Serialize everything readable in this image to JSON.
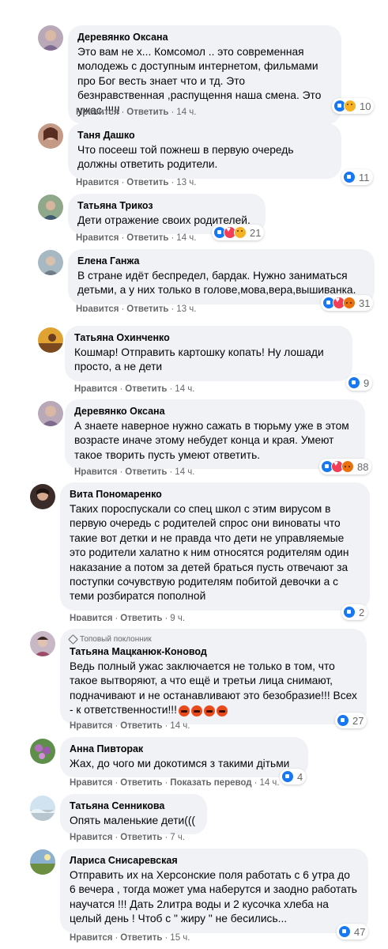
{
  "actions": {
    "like": "Нравится",
    "reply": "Ответить",
    "translate": "Показать перевод"
  },
  "colors": {
    "bubble": "#f0f2f5",
    "meta": "#65676b",
    "like": "#1877f2"
  },
  "comments": [
    {
      "author": "Деревянко Оксана",
      "text": "Это вам не х... Комсомол .. это современная молодежь с доступным интернетом, фильмами про Бог весть знает что и тд. Это безнравственная ,распущення наша смена. Это ужас.!!!!!",
      "time": "14 ч.",
      "reactions": [
        "like",
        "sad"
      ],
      "count": "10",
      "avatar": "woman-avatar"
    },
    {
      "author": "Таня Дашко",
      "text": "Что посееш той пожнеш в первую очередь должны ответить родители.",
      "time": "13 ч.",
      "reactions": [
        "like"
      ],
      "count": "11",
      "avatar": "woman-avatar"
    },
    {
      "author": "Татьяна Трикоз",
      "text": "Дети отражение своих родителей.",
      "time": "14 ч.",
      "reactions": [
        "like",
        "love",
        "sad"
      ],
      "count": "21",
      "avatar": "woman-avatar"
    },
    {
      "author": "Елена Ганжа",
      "text": "В стране идёт беспредел, бардак. Нужно заниматься детьми, а у них только в голове,мова,вера,вышиванка.",
      "time": "13 ч.",
      "reactions": [
        "like",
        "love",
        "angry"
      ],
      "count": "31",
      "avatar": "woman-avatar"
    },
    {
      "author": "Татьяна Охинченко",
      "text": "Кошмар! Отправить картошку копать! Ну лошади просто, а не дети",
      "time": "14 ч.",
      "reactions": [
        "like"
      ],
      "count": "9",
      "avatar": "woman-avatar"
    },
    {
      "author": "Деревянко Оксана",
      "text": "А знаете наверное нужно сажать в тюрьму уже в этом возрасте иначе этому небудет конца и края. Умеют такое творить пусть умеют ответить.",
      "time": "14 ч.",
      "reactions": [
        "like",
        "love",
        "angry"
      ],
      "count": "88",
      "avatar": "woman-avatar"
    },
    {
      "author": "Вита Пономаренко",
      "text": "Таких пороспускали со спец школ с этим вирусом в первую очередь с родителей спрос они виноваты что такие вот детки и не правда что дети не управляемые это родители халатно к ним относятся родителям один наказание а потом за детей браться пусть отвечают за поступки сочувствую родителям побитой девочки а с теми розбиратся пополной",
      "time": "9 ч.",
      "reactions": [
        "like"
      ],
      "count": "2",
      "avatar": "woman-avatar"
    },
    {
      "badge": "Топовый поклонник",
      "author": "Татьяна Мацканюк-Коновод",
      "text": "Ведь полный ужас заключается не только в том, что такое вытворяют, а что ещё и третьи лица снимают, подначивают и не останавливают это безобразие!!! Всех - к ответственности!!!",
      "time": "14 ч.",
      "reactions": [
        "like"
      ],
      "count": "27",
      "avatar": "woman-avatar"
    },
    {
      "author": "Анна Пивторак",
      "text": "Жах, до чого ми докотимся з такими дітьми",
      "time": "14 ч.",
      "reactions": [
        "like"
      ],
      "count": "4",
      "avatar": "flower-avatar",
      "translate": true
    },
    {
      "author": "Татьяна Сенникова",
      "text": "Опять маленькие дети(((",
      "time": "7 ч.",
      "reactions": [],
      "count": "",
      "avatar": "landscape-avatar"
    },
    {
      "author": "Лариса Снисаревская",
      "text": "Отправить их на Херсонские поля работать с 6 утра до 6 вечера , тогда может ума наберутся и заодно работать научатся !!! Дать 2литра воды и 2 кусочка хлеба на целый день ! Чтоб с \" жиру \" не бесились...",
      "time": "15 ч.",
      "reactions": [
        "like"
      ],
      "count": "47",
      "avatar": "landscape-avatar"
    }
  ]
}
